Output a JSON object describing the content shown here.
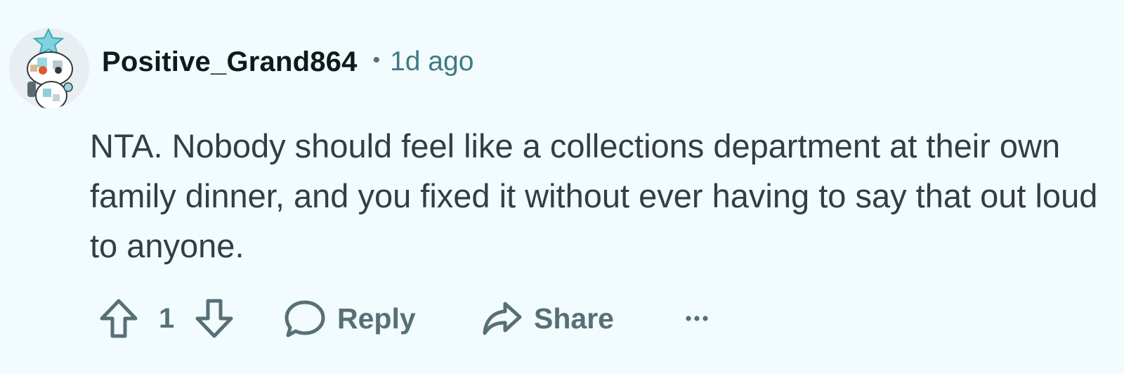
{
  "comment": {
    "author": "Positive_Grand864",
    "separator": "•",
    "timestamp": "1d ago",
    "body": "NTA. Nobody should feel like a collections department at their own family dinner, and you fixed it without ever having to say that out loud to anyone."
  },
  "actions": {
    "score": "1",
    "reply_label": "Reply",
    "share_label": "Share",
    "more_label": "···"
  },
  "icons": {
    "upvote": "upvote-arrow-icon",
    "downvote": "downvote-arrow-icon",
    "reply": "speech-bubble-icon",
    "share": "share-arrow-icon",
    "more": "ellipsis-icon"
  },
  "colors": {
    "background": "#f2fbfd",
    "username": "#0f1a1c",
    "timestamp": "#3e7a86",
    "body_text": "#333d42",
    "action_gray": "#576f76"
  }
}
